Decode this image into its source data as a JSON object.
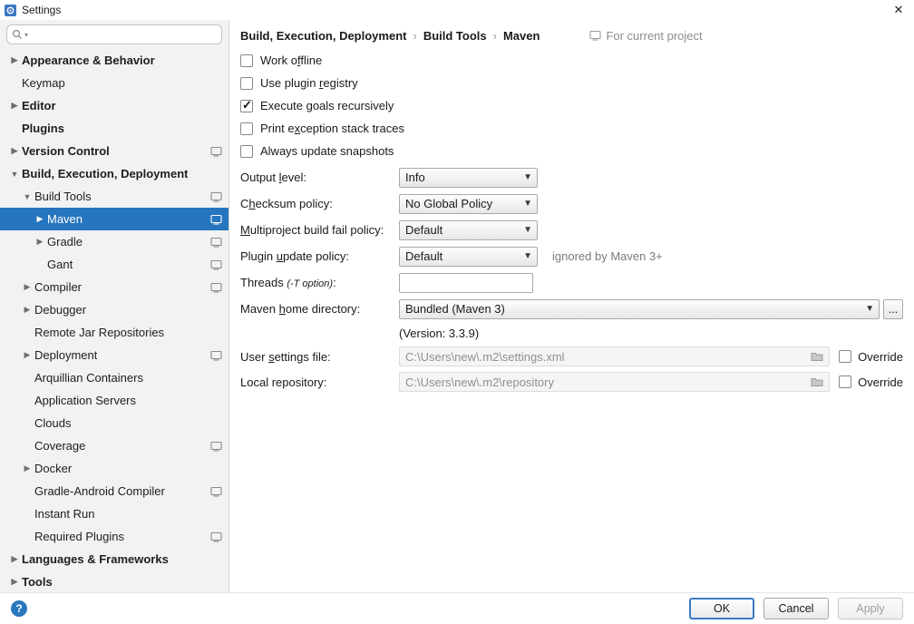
{
  "window": {
    "title": "Settings"
  },
  "colors": {
    "selection_blue": "#2675BF",
    "help_blue": "#2B77BC",
    "ok_border_blue": "#3A79C4",
    "sidebar_bg": "#F2F2F2"
  },
  "icons": {
    "search": "magnifier",
    "search_dropdown": "▾",
    "chevron_collapsed": "▶",
    "chevron_expanded": "▼",
    "dropdown_arrow": "▼",
    "project_settings": "screen",
    "folder": "folder",
    "close": "✕",
    "help": "?",
    "browse": "..."
  },
  "sidebar": {
    "search_value": "",
    "items": [
      {
        "label": "Appearance & Behavior",
        "level": 0,
        "bold": true,
        "chevron": "collapsed"
      },
      {
        "label": "Keymap",
        "level": 0
      },
      {
        "label": "Editor",
        "level": 0,
        "bold": true,
        "chevron": "collapsed"
      },
      {
        "label": "Plugins",
        "level": 0,
        "bold": true
      },
      {
        "label": "Version Control",
        "level": 0,
        "bold": true,
        "chevron": "collapsed",
        "badge": true
      },
      {
        "label": "Build, Execution, Deployment",
        "level": 0,
        "bold": true,
        "chevron": "expanded"
      },
      {
        "label": "Build Tools",
        "level": 1,
        "chevron": "expanded",
        "badge": true
      },
      {
        "label": "Maven",
        "level": 2,
        "chevron": "collapsed",
        "badge": true,
        "selected": true
      },
      {
        "label": "Gradle",
        "level": 2,
        "chevron": "collapsed",
        "badge": true
      },
      {
        "label": "Gant",
        "level": 2,
        "badge": true
      },
      {
        "label": "Compiler",
        "level": 1,
        "chevron": "collapsed",
        "badge": true
      },
      {
        "label": "Debugger",
        "level": 1,
        "chevron": "collapsed"
      },
      {
        "label": "Remote Jar Repositories",
        "level": 1
      },
      {
        "label": "Deployment",
        "level": 1,
        "chevron": "collapsed",
        "badge": true
      },
      {
        "label": "Arquillian Containers",
        "level": 1
      },
      {
        "label": "Application Servers",
        "level": 1
      },
      {
        "label": "Clouds",
        "level": 1
      },
      {
        "label": "Coverage",
        "level": 1,
        "badge": true
      },
      {
        "label": "Docker",
        "level": 1,
        "chevron": "collapsed"
      },
      {
        "label": "Gradle-Android Compiler",
        "level": 1,
        "badge": true
      },
      {
        "label": "Instant Run",
        "level": 1
      },
      {
        "label": "Required Plugins",
        "level": 1,
        "badge": true
      },
      {
        "label": "Languages & Frameworks",
        "level": 0,
        "bold": true,
        "chevron": "collapsed"
      },
      {
        "label": "Tools",
        "level": 0,
        "bold": true,
        "chevron": "collapsed"
      }
    ]
  },
  "breadcrumb": {
    "parts": [
      "Build, Execution, Deployment",
      "Build Tools",
      "Maven"
    ],
    "separator": "›",
    "context_note": "For current project"
  },
  "checkboxes": [
    {
      "label_html": "Work o<u>f</u>fline",
      "checked": false
    },
    {
      "label_html": "Use plugin <u>r</u>egistry",
      "checked": false
    },
    {
      "label_html": "Execute <u>g</u>oals recursively",
      "checked": true
    },
    {
      "label_html": "Print e<u>x</u>ception stack traces",
      "checked": false
    },
    {
      "label_html": "Always update snapshots",
      "checked": false
    }
  ],
  "fields": {
    "output_level": {
      "label_html": "Output <u>l</u>evel:",
      "value": "Info"
    },
    "checksum_policy": {
      "label_html": "C<u>h</u>ecksum policy:",
      "value": "No Global Policy"
    },
    "multiproject_fail": {
      "label_html": "<u>M</u>ultiproject build fail policy:",
      "value": "Default"
    },
    "plugin_update_policy": {
      "label_html": "Plugin <u>u</u>pdate policy:",
      "value": "Default",
      "note": "ignored by Maven 3+"
    },
    "threads": {
      "label_html": "Threads <i>(-T option)</i>:",
      "value": ""
    },
    "maven_home": {
      "label_html": "Maven <u>h</u>ome directory:",
      "value": "Bundled (Maven 3)",
      "version_note": "(Version: 3.3.9)"
    },
    "user_settings": {
      "label_html": "User <u>s</u>ettings file:",
      "value": "C:\\Users\\new\\.m2\\settings.xml",
      "override_label": "Override",
      "override_checked": false
    },
    "local_repository": {
      "label_html": "Local repository:",
      "value": "C:\\Users\\new\\.m2\\repository",
      "override_label": "Override",
      "override_checked": false
    }
  },
  "footer": {
    "ok": "OK",
    "cancel": "Cancel",
    "apply": "Apply"
  }
}
